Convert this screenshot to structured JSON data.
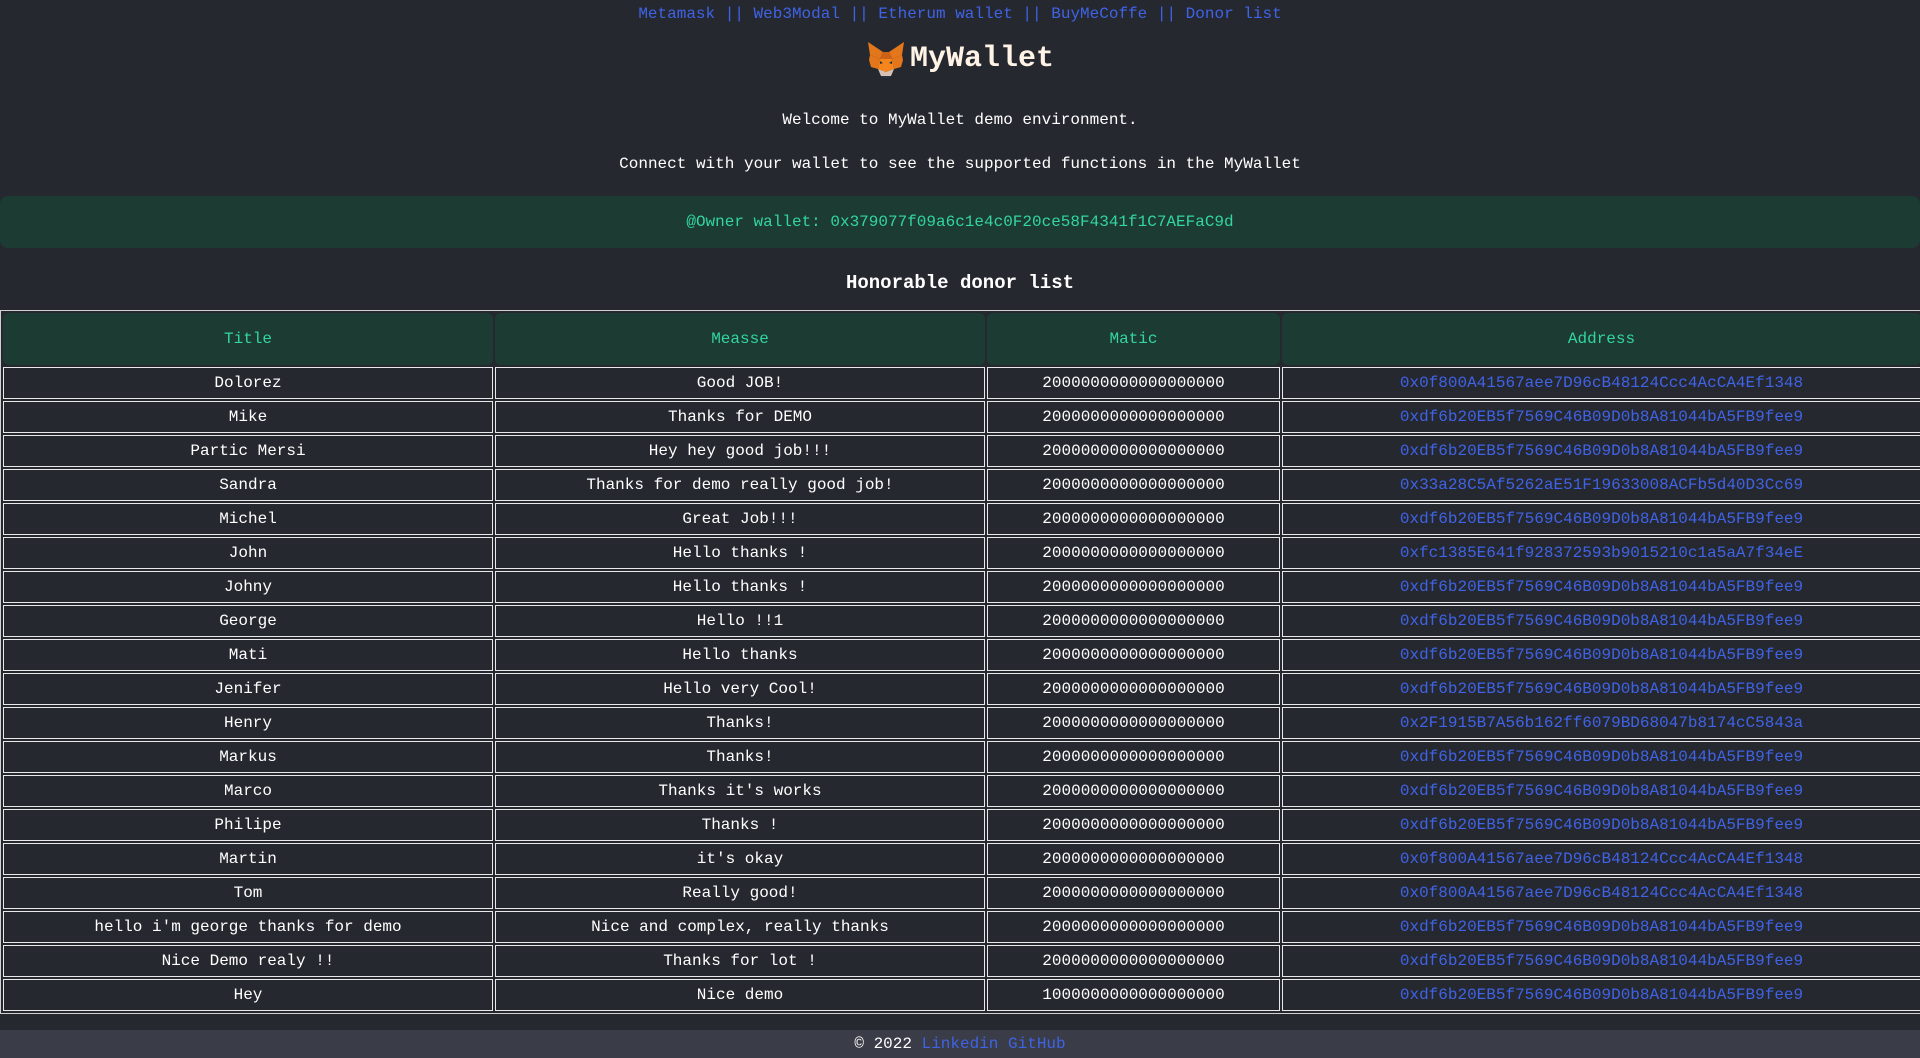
{
  "nav": {
    "links": [
      "Metamask",
      "Web3Modal",
      "Etherum wallet",
      "BuyMeCoffe",
      "Donor list"
    ],
    "separator": "||"
  },
  "brand": {
    "icon": "metamask-fox-icon",
    "name": "MyWallet"
  },
  "intro": {
    "welcome": "Welcome to MyWallet demo environment.",
    "connect": "Connect with your wallet to see the supported functions in the MyWallet"
  },
  "owner": {
    "text": "@Owner wallet: 0x379077f09a6c1e4c0F20ce58F4341f1C7AEFaC9d"
  },
  "donors": {
    "title": "Honorable donor list",
    "columns": [
      "Title",
      "Measse",
      "Matic",
      "Address"
    ],
    "rows": [
      [
        "Dolorez",
        "Good JOB!",
        "2000000000000000000",
        "0x0f800A41567aee7D96cB48124Ccc4AcCA4Ef1348"
      ],
      [
        "Mike",
        "Thanks for DEMO",
        "2000000000000000000",
        "0xdf6b20EB5f7569C46B09D0b8A81044bA5FB9fee9"
      ],
      [
        "Partic Mersi",
        "Hey hey good job!!!",
        "2000000000000000000",
        "0xdf6b20EB5f7569C46B09D0b8A81044bA5FB9fee9"
      ],
      [
        "Sandra",
        "Thanks for demo really good job!",
        "2000000000000000000",
        "0x33a28C5Af5262aE51F19633008ACFb5d40D3Cc69"
      ],
      [
        "Michel",
        "Great Job!!!",
        "2000000000000000000",
        "0xdf6b20EB5f7569C46B09D0b8A81044bA5FB9fee9"
      ],
      [
        "John",
        "Hello thanks !",
        "2000000000000000000",
        "0xfc1385E641f928372593b9015210c1a5aA7f34eE"
      ],
      [
        "Johny",
        "Hello thanks !",
        "2000000000000000000",
        "0xdf6b20EB5f7569C46B09D0b8A81044bA5FB9fee9"
      ],
      [
        "George",
        "Hello !!1",
        "2000000000000000000",
        "0xdf6b20EB5f7569C46B09D0b8A81044bA5FB9fee9"
      ],
      [
        "Mati",
        "Hello thanks",
        "2000000000000000000",
        "0xdf6b20EB5f7569C46B09D0b8A81044bA5FB9fee9"
      ],
      [
        "Jenifer",
        "Hello very Cool!",
        "2000000000000000000",
        "0xdf6b20EB5f7569C46B09D0b8A81044bA5FB9fee9"
      ],
      [
        "Henry",
        "Thanks!",
        "2000000000000000000",
        "0x2F1915B7A56b162ff6079BD68047b8174cC5843a"
      ],
      [
        "Markus",
        "Thanks!",
        "2000000000000000000",
        "0xdf6b20EB5f7569C46B09D0b8A81044bA5FB9fee9"
      ],
      [
        "Marco",
        "Thanks it's works",
        "2000000000000000000",
        "0xdf6b20EB5f7569C46B09D0b8A81044bA5FB9fee9"
      ],
      [
        "Philipe",
        "Thanks !",
        "2000000000000000000",
        "0xdf6b20EB5f7569C46B09D0b8A81044bA5FB9fee9"
      ],
      [
        "Martin",
        "it's okay",
        "2000000000000000000",
        "0x0f800A41567aee7D96cB48124Ccc4AcCA4Ef1348"
      ],
      [
        "Tom",
        "Really good!",
        "2000000000000000000",
        "0x0f800A41567aee7D96cB48124Ccc4AcCA4Ef1348"
      ],
      [
        "hello i'm george thanks for demo",
        "Nice and complex, really thanks",
        "2000000000000000000",
        "0xdf6b20EB5f7569C46B09D0b8A81044bA5FB9fee9"
      ],
      [
        "Nice Demo realy !!",
        "Thanks for lot !",
        "2000000000000000000",
        "0xdf6b20EB5f7569C46B09D0b8A81044bA5FB9fee9"
      ],
      [
        "Hey",
        "Nice demo",
        "1000000000000000000",
        "0xdf6b20EB5f7569C46B09D0b8A81044bA5FB9fee9"
      ]
    ]
  },
  "footer": {
    "copyright": "© 2022",
    "links": [
      "Linkedin",
      "GitHub"
    ]
  },
  "colors": {
    "background": "#262830",
    "accent_green": "#33d69f",
    "link_blue": "#3f63e6",
    "panel_green": "#1c3b33"
  }
}
